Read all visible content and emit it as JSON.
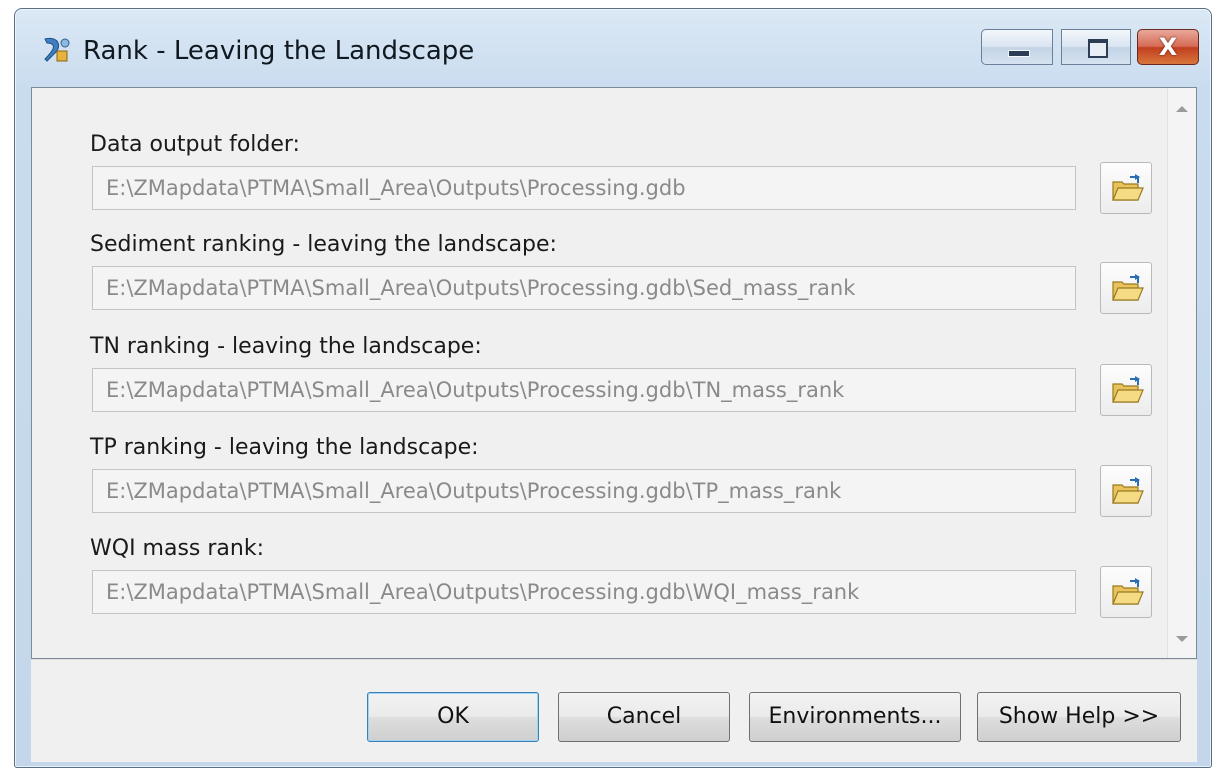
{
  "window": {
    "title": "Rank - Leaving the Landscape",
    "icon": "toolbox-tool-icon",
    "controls": {
      "minimize": "minimize-icon",
      "maximize": "maximize-icon",
      "close_glyph": "X"
    }
  },
  "fields": [
    {
      "label": "Data output folder:",
      "value": "E:\\ZMapdata\\PTMA\\Small_Area\\Outputs\\Processing.gdb",
      "browse_icon": "open-folder-icon"
    },
    {
      "label": "Sediment ranking - leaving the landscape:",
      "value": "E:\\ZMapdata\\PTMA\\Small_Area\\Outputs\\Processing.gdb\\Sed_mass_rank",
      "browse_icon": "open-folder-icon"
    },
    {
      "label": "TN ranking - leaving the landscape:",
      "value": "E:\\ZMapdata\\PTMA\\Small_Area\\Outputs\\Processing.gdb\\TN_mass_rank",
      "browse_icon": "open-folder-icon"
    },
    {
      "label": "TP ranking - leaving the landscape:",
      "value": "E:\\ZMapdata\\PTMA\\Small_Area\\Outputs\\Processing.gdb\\TP_mass_rank",
      "browse_icon": "open-folder-icon"
    },
    {
      "label": "WQI mass rank:",
      "value": "E:\\ZMapdata\\PTMA\\Small_Area\\Outputs\\Processing.gdb\\WQI_mass_rank",
      "browse_icon": "open-folder-icon"
    }
  ],
  "buttons": {
    "ok": "OK",
    "cancel": "Cancel",
    "environments": "Environments...",
    "show_help": "Show Help >>"
  },
  "colors": {
    "frame": "#c9dcef",
    "client": "#f0f0f0",
    "close_button": "#c0401f",
    "default_button_border": "#3c7fb1"
  }
}
